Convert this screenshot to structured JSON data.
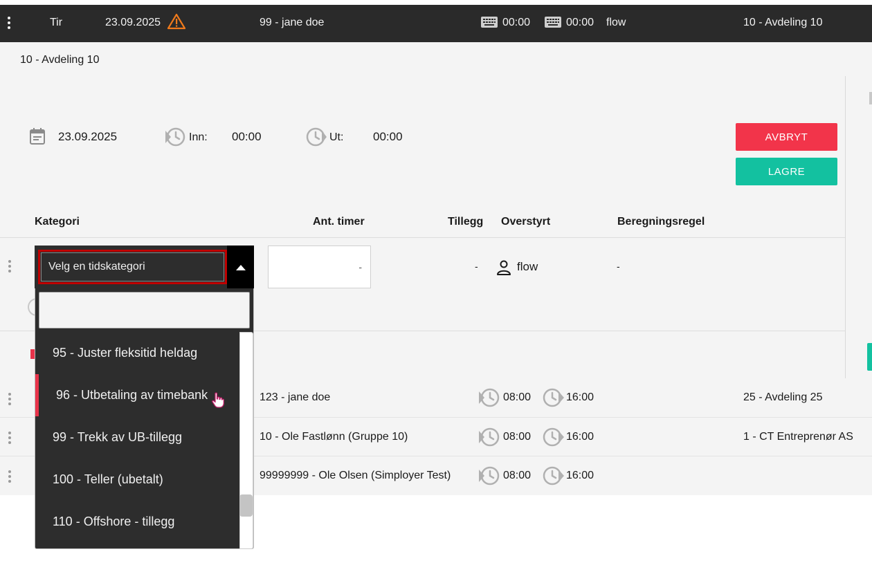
{
  "top_row": {
    "day": "Tir",
    "date": "23.09.2025",
    "employee": "99 - jane doe",
    "clock_in": "00:00",
    "clock_out": "00:00",
    "user": "flow",
    "department": "10 - Avdeling 10"
  },
  "panel": {
    "department": "10 - Avdeling 10",
    "date": "23.09.2025",
    "in_label": "Inn:",
    "in_time": "00:00",
    "out_label": "Ut:",
    "out_time": "00:00",
    "cancel_label": "AVBRYT",
    "save_label": "LAGRE",
    "headers": {
      "category": "Kategori",
      "hours": "Ant. timer",
      "supplement": "Tillegg",
      "override": "Overstyrt",
      "rule": "Beregningsregel"
    },
    "line": {
      "category_placeholder": "Velg en tidskategori",
      "hours_value": "-",
      "supplement": "-",
      "override_user": "flow",
      "rule": "-"
    }
  },
  "dropdown": {
    "items": [
      "95 - Juster fleksitid heldag",
      "96 - Utbetaling av timebank",
      "99 - Trekk av UB-tillegg",
      "100 - Teller (ubetalt)",
      "110 - Offshore - tillegg"
    ],
    "active_index": 1
  },
  "rows": [
    {
      "employee": "123 - jane doe",
      "in": "08:00",
      "out": "16:00",
      "department": "25 - Avdeling 25"
    },
    {
      "employee": "10 - Ole Fastlønn (Gruppe 10)",
      "in": "08:00",
      "out": "16:00",
      "department": "1 - CT Entreprenør AS"
    },
    {
      "employee": "99999999 - Ole Olsen (Simployer Test)",
      "in": "08:00",
      "out": "16:00",
      "department": ""
    }
  ],
  "colors": {
    "top_row_bg": "#2a2a2a",
    "cancel": "#f2344a",
    "save": "#13c1a0",
    "warning": "#f07a1b",
    "active_marker": "#e8334a",
    "focus_border": "#c00000"
  },
  "icons": [
    "kebab-menu-icon",
    "warning-icon",
    "keyboard-icon",
    "calendar-icon",
    "clock-in-icon",
    "clock-out-icon",
    "user-icon",
    "caret-up-icon",
    "hand-cursor-icon"
  ]
}
